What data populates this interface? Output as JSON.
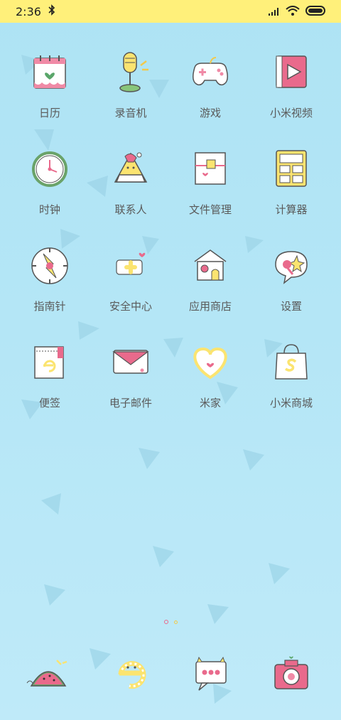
{
  "status_bar": {
    "time": "2:36",
    "icons": [
      "bluetooth-icon",
      "signal-icon",
      "wifi-icon",
      "battery-icon"
    ]
  },
  "apps": [
    {
      "label": "日历",
      "icon": "calendar-icon"
    },
    {
      "label": "录音机",
      "icon": "microphone-icon"
    },
    {
      "label": "游戏",
      "icon": "gamepad-icon"
    },
    {
      "label": "小米视频",
      "icon": "video-icon"
    },
    {
      "label": "时钟",
      "icon": "clock-icon"
    },
    {
      "label": "联系人",
      "icon": "contacts-icon"
    },
    {
      "label": "文件管理",
      "icon": "file-manager-icon"
    },
    {
      "label": "计算器",
      "icon": "calculator-icon"
    },
    {
      "label": "指南针",
      "icon": "compass-icon"
    },
    {
      "label": "安全中心",
      "icon": "security-icon"
    },
    {
      "label": "应用商店",
      "icon": "app-store-icon"
    },
    {
      "label": "设置",
      "icon": "settings-icon"
    },
    {
      "label": "便签",
      "icon": "notes-icon"
    },
    {
      "label": "电子邮件",
      "icon": "email-icon"
    },
    {
      "label": "米家",
      "icon": "mijia-icon"
    },
    {
      "label": "小米商城",
      "icon": "mi-store-icon"
    }
  ],
  "dock": [
    {
      "icon": "phone-watermelon-icon"
    },
    {
      "icon": "browser-icon"
    },
    {
      "icon": "messages-icon"
    },
    {
      "icon": "camera-icon"
    }
  ],
  "pager": {
    "pages": 2,
    "current": 2
  },
  "colors": {
    "status_bar": "#fff07a",
    "background": "#b4e6f6",
    "accent_pink": "#e96a8c",
    "accent_yellow": "#f7e36b"
  }
}
